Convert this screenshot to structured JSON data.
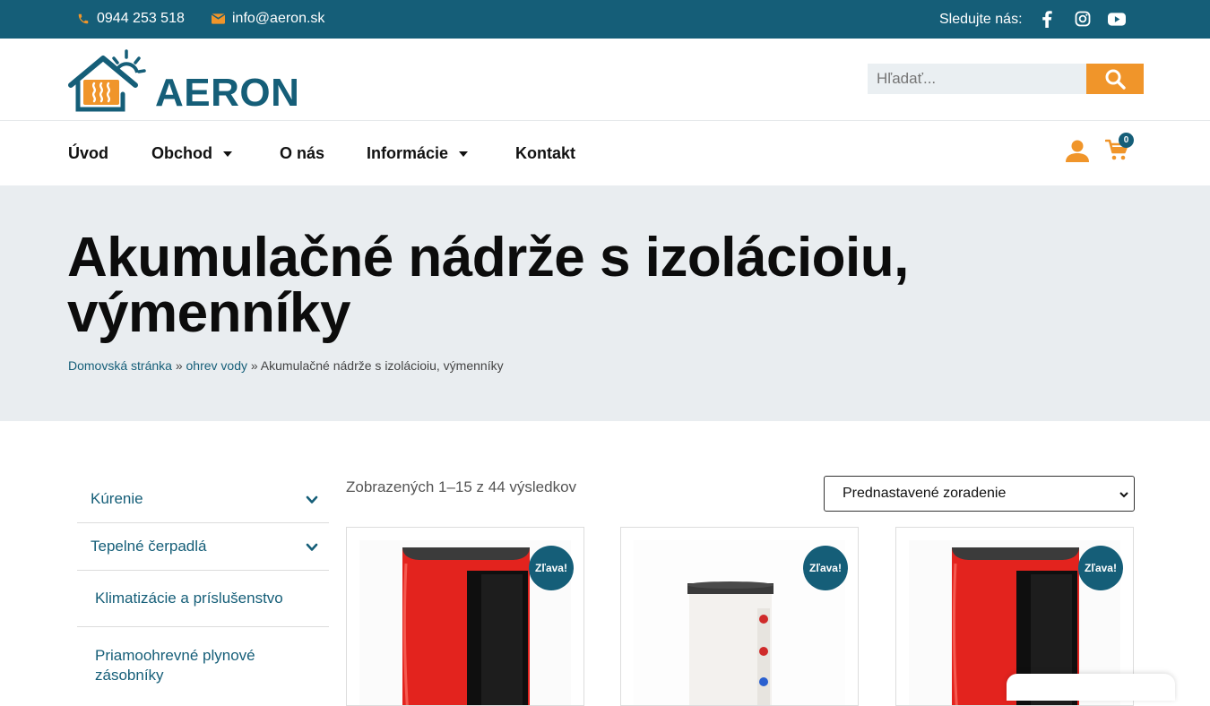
{
  "topbar": {
    "phone": "0944 253 518",
    "email": "info@aeron.sk",
    "follow_label": "Sledujte nás:",
    "social": [
      "facebook-icon",
      "instagram-icon",
      "youtube-icon"
    ]
  },
  "header": {
    "logo_text": "AERON",
    "search_placeholder": "Hľadať..."
  },
  "nav": {
    "items": [
      {
        "label": "Úvod",
        "has_dropdown": false
      },
      {
        "label": "Obchod",
        "has_dropdown": true
      },
      {
        "label": "O nás",
        "has_dropdown": false
      },
      {
        "label": "Informácie",
        "has_dropdown": true
      },
      {
        "label": "Kontakt",
        "has_dropdown": false
      }
    ],
    "cart_count": "0"
  },
  "hero": {
    "title": "Akumulačné nádrže s izolácioiu, výmenníky",
    "breadcrumb": {
      "home": "Domovská stránka",
      "sep1": " » ",
      "parent": "ohrev vody",
      "sep2": " » ",
      "current": "Akumulačné nádrže s izolácioiu, výmenníky"
    }
  },
  "sidebar": {
    "items": [
      {
        "label": "Kúrenie",
        "expandable": true
      },
      {
        "label": "Tepelné čerpadlá",
        "expandable": true
      },
      {
        "label": "Klimatizácie a príslušenstvo",
        "expandable": false
      },
      {
        "label": "Priamoohrevné plynové zásobníky",
        "expandable": false
      }
    ]
  },
  "shop": {
    "result_count": "Zobrazených 1–15 z 44 výsledkov",
    "sort_selected": "Prednastavené zoradenie",
    "sale_label": "Zľava!"
  },
  "colors": {
    "brand": "#155e78",
    "accent": "#f0952a",
    "hero_bg": "#e9edf0"
  }
}
